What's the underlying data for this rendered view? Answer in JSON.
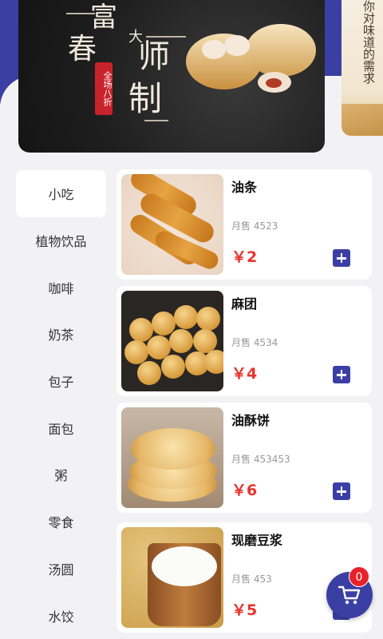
{
  "banner": {
    "title_chars": [
      "富",
      "春",
      "大",
      "师",
      "制"
    ],
    "stamp": "全场八折",
    "side_text": "你对味道的需求"
  },
  "categories": [
    {
      "label": "小吃",
      "active": true
    },
    {
      "label": "植物饮品"
    },
    {
      "label": "咖啡"
    },
    {
      "label": "奶茶"
    },
    {
      "label": "包子"
    },
    {
      "label": "面包"
    },
    {
      "label": "粥"
    },
    {
      "label": "零食"
    },
    {
      "label": "汤圆"
    },
    {
      "label": "水饺"
    }
  ],
  "products": [
    {
      "name": "油条",
      "sold": "月售 4523",
      "price": "￥2"
    },
    {
      "name": "麻团",
      "sold": "月售 4534",
      "price": "￥4"
    },
    {
      "name": "油酥饼",
      "sold": "月售 453453",
      "price": "￥6"
    },
    {
      "name": "现磨豆浆",
      "sold": "月售 453",
      "price": "￥5"
    }
  ],
  "cart": {
    "count": "0",
    "icon": "cart-icon"
  },
  "colors": {
    "primary": "#3b3fa4",
    "price": "#e8342c",
    "badge": "#e7222a"
  }
}
